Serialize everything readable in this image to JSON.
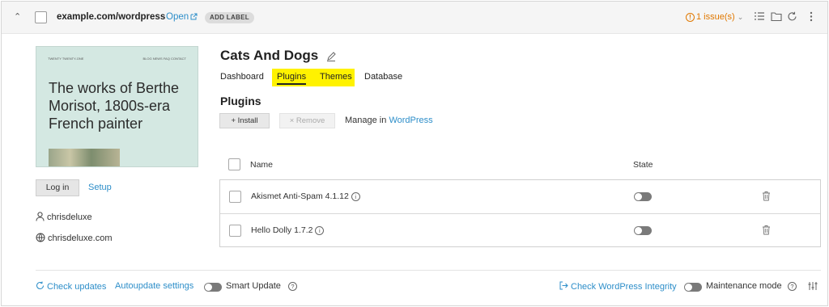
{
  "header": {
    "domain": "example.com/wordpress",
    "open_label": "Open",
    "add_label": "ADD LABEL",
    "issues_label": "1 issue(s)",
    "issue_badge": "!"
  },
  "preview": {
    "nav_left": "TWENTY TWENTY-ONE",
    "nav_right": "BLOG   NEWS   FAQ   CONTACT",
    "headline": "The works of Berthe Morisot, 1800s-era French painter"
  },
  "sidebar": {
    "login_label": "Log in",
    "setup_label": "Setup",
    "username": "chrisdeluxe",
    "website": "chrisdeluxe.com"
  },
  "site": {
    "title": "Cats And Dogs",
    "tabs": [
      "Dashboard",
      "Plugins",
      "Themes",
      "Database"
    ],
    "active_tab": "Plugins",
    "highlight_color": "#fff200"
  },
  "plugins": {
    "section_title": "Plugins",
    "install_label": "+ Install",
    "remove_label": "× Remove",
    "manage_prefix": "Manage in",
    "manage_link": "WordPress",
    "columns": {
      "name": "Name",
      "state": "State"
    },
    "rows": [
      {
        "name": "Akismet Anti-Spam 4.1.12",
        "state": "off"
      },
      {
        "name": "Hello Dolly 1.7.2",
        "state": "off"
      }
    ]
  },
  "footer": {
    "check_updates": "Check updates",
    "autoupdate": "Autoupdate settings",
    "smart_update": "Smart Update",
    "check_integrity": "Check WordPress Integrity",
    "maintenance": "Maintenance mode",
    "help_glyph": "?"
  },
  "colors": {
    "link": "#2d8ec9",
    "warning": "#e07800"
  }
}
